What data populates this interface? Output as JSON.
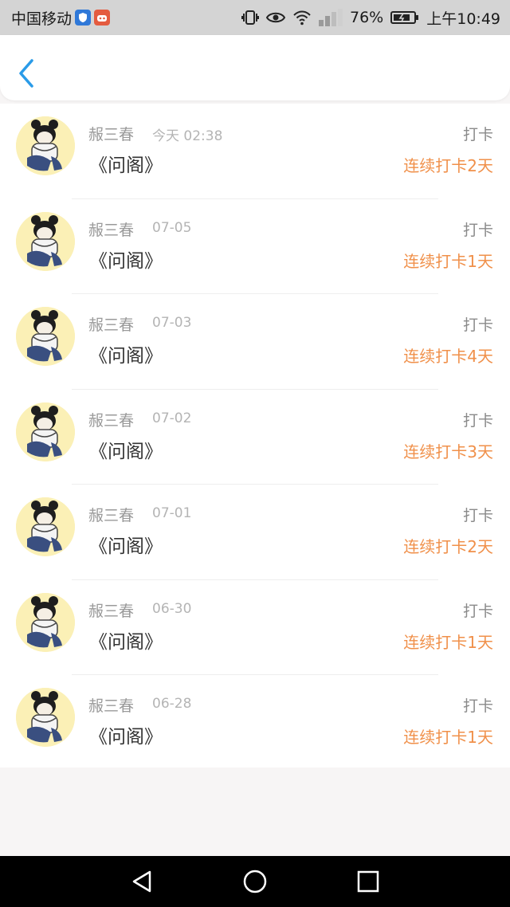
{
  "status_bar": {
    "carrier": "中国移动",
    "battery": "76%",
    "time": "上午10:49"
  },
  "checkins": [
    {
      "name": "赧三春",
      "date": "今天 02:38",
      "title": "《问阁》",
      "type": "打卡",
      "streak": "连续打卡2天"
    },
    {
      "name": "赧三春",
      "date": "07-05",
      "title": "《问阁》",
      "type": "打卡",
      "streak": "连续打卡1天"
    },
    {
      "name": "赧三春",
      "date": "07-03",
      "title": "《问阁》",
      "type": "打卡",
      "streak": "连续打卡4天"
    },
    {
      "name": "赧三春",
      "date": "07-02",
      "title": "《问阁》",
      "type": "打卡",
      "streak": "连续打卡3天"
    },
    {
      "name": "赧三春",
      "date": "07-01",
      "title": "《问阁》",
      "type": "打卡",
      "streak": "连续打卡2天"
    },
    {
      "name": "赧三春",
      "date": "06-30",
      "title": "《问阁》",
      "type": "打卡",
      "streak": "连续打卡1天"
    },
    {
      "name": "赧三春",
      "date": "06-28",
      "title": "《问阁》",
      "type": "打卡",
      "streak": "连续打卡1天"
    }
  ],
  "colors": {
    "accent_back": "#2a9be8",
    "streak": "#f0904a",
    "avatar_bg": "#fbf0b6"
  },
  "icons": {
    "back": "chevron-left-icon",
    "nav": [
      "back-triangle-icon",
      "home-circle-icon",
      "recents-square-icon"
    ]
  }
}
